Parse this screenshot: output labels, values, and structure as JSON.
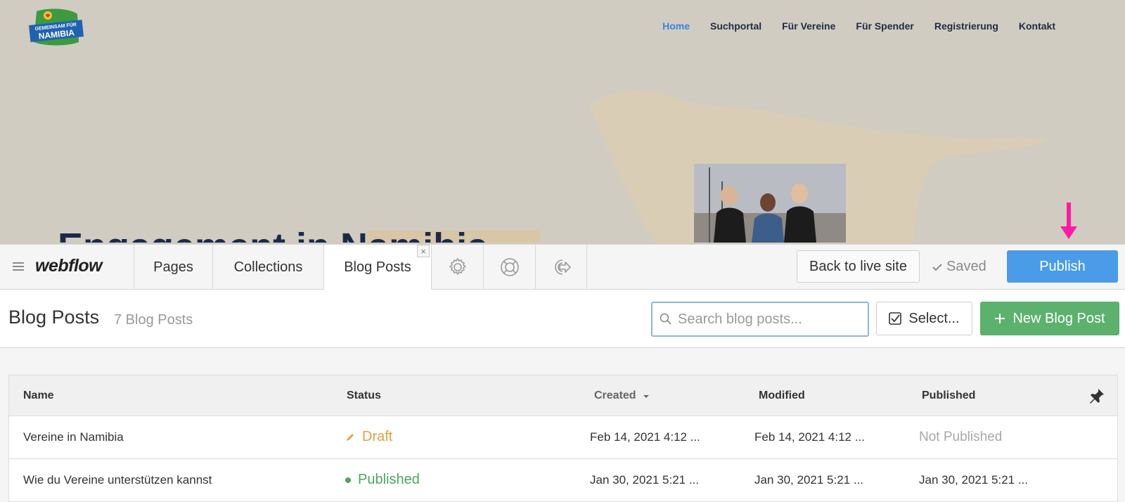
{
  "site": {
    "logo_text_line1": "GEMEINSAM FÜR",
    "logo_text_line2": "NAMIBIA",
    "nav": [
      "Home",
      "Suchportal",
      "Für Vereine",
      "Für Spender",
      "Registrierung",
      "Kontakt"
    ],
    "active_nav": "Home",
    "heading": "Engagement in Namibia"
  },
  "editor": {
    "logo": "webflow",
    "tabs": {
      "pages": "Pages",
      "collections": "Collections",
      "blog_posts": "Blog Posts",
      "close_glyph": "×"
    },
    "icons": [
      "gear-icon",
      "help-lifebuoy-icon",
      "logout-icon"
    ],
    "back_button": "Back to live site",
    "saved_label": "Saved",
    "publish_button": "Publish",
    "page_title": "Blog Posts",
    "page_count": "7 Blog Posts",
    "search_placeholder": "Search blog posts...",
    "select_button": "Select...",
    "new_button": "New Blog Post"
  },
  "table": {
    "columns": {
      "name": "Name",
      "status": "Status",
      "created": "Created",
      "modified": "Modified",
      "published": "Published"
    },
    "rows": [
      {
        "name": "Vereine in Namibia",
        "status": "Draft",
        "created": "Feb 14, 2021 4:12 ...",
        "modified": "Feb 14, 2021 4:12 ...",
        "published": "Not Published"
      },
      {
        "name": "Wie du Vereine unterstützen kannst",
        "status": "Published",
        "created": "Jan 30, 2021 5:21 ...",
        "modified": "Jan 30, 2021 5:21 ...",
        "published": "Jan 30, 2021 5:21 ..."
      }
    ]
  },
  "colors": {
    "publish": "#4a9ce8",
    "new_post": "#5cb16c",
    "draft": "#e0a33b",
    "published": "#4ca65b",
    "annotation_arrow": "#ff1aa8"
  }
}
